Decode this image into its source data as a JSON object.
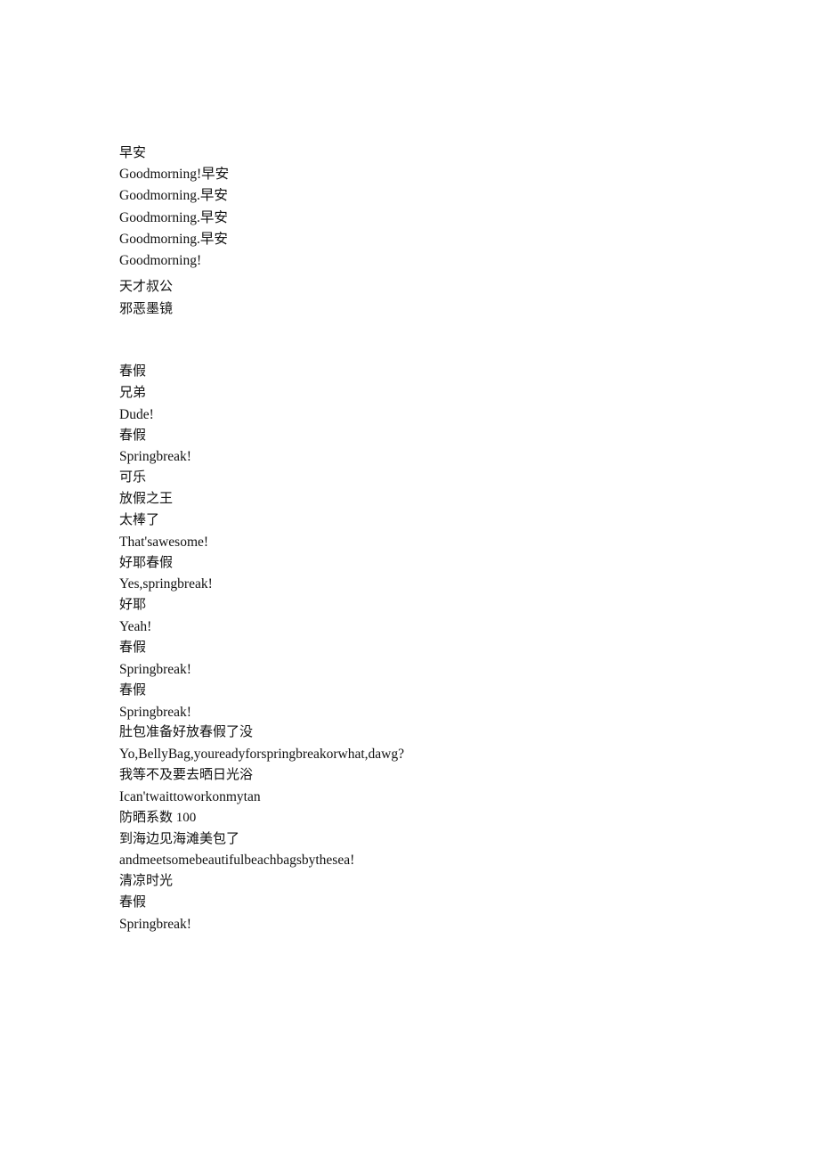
{
  "document": {
    "sections": [
      {
        "lines": [
          {
            "text": "早安",
            "lang": "zh"
          },
          {
            "text": "Goodmorning!早安",
            "lang": "mixed"
          },
          {
            "text": "Goodmorning.早安",
            "lang": "mixed"
          },
          {
            "text": "Goodmorning.早安",
            "lang": "mixed"
          },
          {
            "text": "Goodmorning.早安",
            "lang": "mixed"
          },
          {
            "text": "Goodmorning!",
            "lang": "en"
          }
        ]
      },
      {
        "lines": [
          {
            "text": "天才叔公",
            "lang": "zh"
          },
          {
            "text": "邪恶墨镜",
            "lang": "zh"
          }
        ]
      },
      {
        "lines": [
          {
            "text": "春假",
            "lang": "zh"
          },
          {
            "text": "兄弟",
            "lang": "zh"
          },
          {
            "text": "Dude!",
            "lang": "en"
          },
          {
            "text": "春假",
            "lang": "zh"
          },
          {
            "text": "Springbreak!",
            "lang": "en"
          },
          {
            "text": "可乐",
            "lang": "zh"
          },
          {
            "text": "放假之王",
            "lang": "zh"
          },
          {
            "text": "太棒了",
            "lang": "zh"
          },
          {
            "text": "That'sawesome!",
            "lang": "en"
          },
          {
            "text": "好耶春假",
            "lang": "zh"
          },
          {
            "text": "Yes,springbreak!",
            "lang": "en"
          },
          {
            "text": "好耶",
            "lang": "zh"
          },
          {
            "text": "Yeah!",
            "lang": "en"
          },
          {
            "text": "春假",
            "lang": "zh"
          },
          {
            "text": "Springbreak!",
            "lang": "en"
          },
          {
            "text": "春假",
            "lang": "zh"
          },
          {
            "text": "Springbreak!",
            "lang": "en"
          },
          {
            "text": "肚包准备好放春假了没",
            "lang": "zh"
          },
          {
            "text": "Yo,BellyBag,youreadyforspringbreakorwhat,dawg?",
            "lang": "en"
          },
          {
            "text": "我等不及要去晒日光浴",
            "lang": "zh"
          },
          {
            "text": "Ican'twaittoworkonmytan",
            "lang": "en"
          },
          {
            "text": "防晒系数 100",
            "lang": "zh"
          },
          {
            "text": "到海边见海滩美包了",
            "lang": "zh"
          },
          {
            "text": "andmeetsomebeautifulbeachbagsbythesea!",
            "lang": "en"
          },
          {
            "text": "清凉时光",
            "lang": "zh"
          },
          {
            "text": "春假",
            "lang": "zh"
          },
          {
            "text": "Springbreak!",
            "lang": "en"
          }
        ]
      }
    ]
  }
}
